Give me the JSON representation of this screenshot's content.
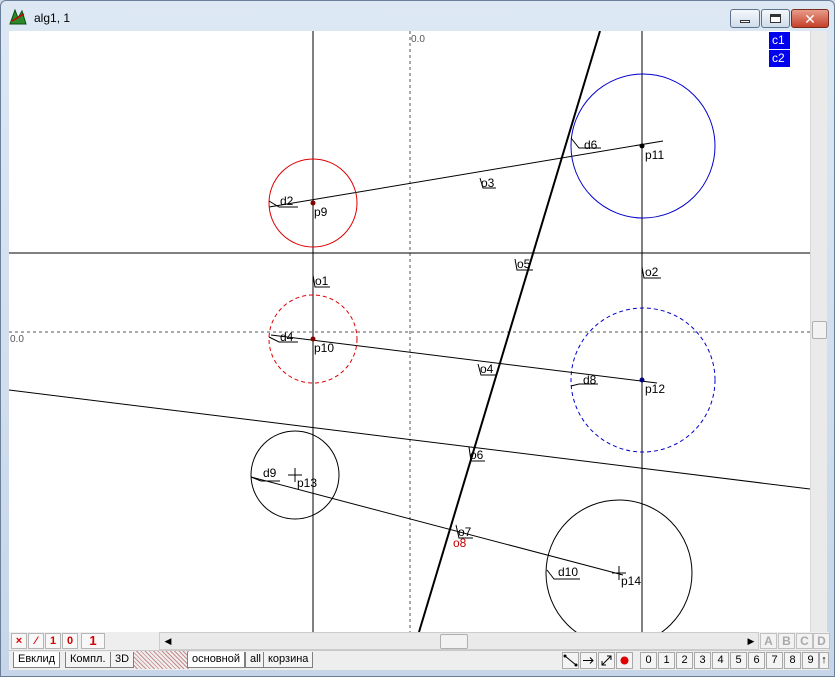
{
  "window": {
    "title": "alg1, 1"
  },
  "legend": [
    "c1",
    "c2"
  ],
  "axes": {
    "x_origin_label": "0.0",
    "y_origin_label": "0.0"
  },
  "labels": {
    "d2": "d2",
    "p9": "p9",
    "o3": "o3",
    "d6": "d6",
    "p11": "p11",
    "o1": "o1",
    "o5": "o5",
    "o2": "o2",
    "d4": "d4",
    "p10": "p10",
    "o4": "o4",
    "d8": "d8",
    "p12": "p12",
    "o6": "o6",
    "d9": "d9",
    "p13": "p13",
    "o7": "o7",
    "o8": "o8",
    "d10": "d10",
    "p14": "p14"
  },
  "colors": {
    "red": "#e00000",
    "blue": "#0000cc",
    "legend_bg": "#0000ee"
  },
  "status_buttons": [
    "×",
    "⁄",
    "1",
    "0"
  ],
  "status_counter": "1",
  "letter_buttons": [
    "A",
    "B",
    "C",
    "D"
  ],
  "tabs_left": [
    "Евклид",
    "Компл.",
    "3D"
  ],
  "tabs_right": [
    "основной",
    "all",
    "корзина"
  ],
  "tool_icons": [
    "segment-icon",
    "arrow-right-icon",
    "diagonal-arrow-icon",
    "record-icon"
  ],
  "number_buttons": [
    "0",
    "1",
    "2",
    "3",
    "4",
    "5",
    "6",
    "7",
    "8",
    "9",
    "↑"
  ]
}
